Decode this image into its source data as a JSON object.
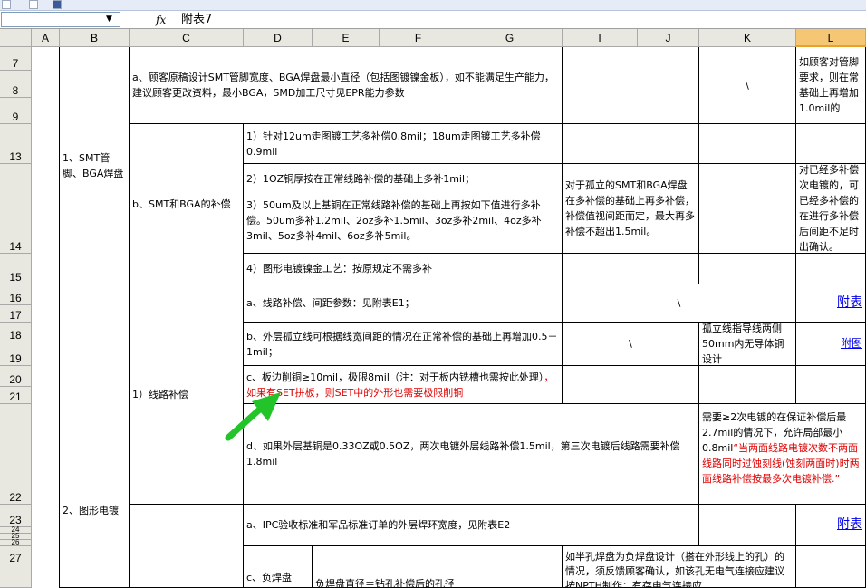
{
  "toolbar": {
    "icons": [
      "pdf-icon",
      "pdf-icon",
      "menu-icon"
    ]
  },
  "formula_bar": {
    "name_box": "",
    "fx": "fx",
    "value": "附表7"
  },
  "columns": [
    "A",
    "B",
    "C",
    "D",
    "E",
    "F",
    "G",
    "I",
    "J",
    "K",
    "L"
  ],
  "rows": [
    "7",
    "8",
    "9",
    "13",
    "14",
    "15",
    "16",
    "17",
    "18",
    "19",
    "20",
    "21",
    "22",
    "23",
    "24",
    "25",
    "26",
    "27"
  ],
  "cells": {
    "b_smt": "1、SMT管脚、BGA焊盘",
    "b_plating": "2、图形电镀",
    "c_smt_a": "a、顾客原稿设计SMT管脚宽度、BGA焊盘最小直径（包括图镀镍金板），如不能满足生产能力，建议顾客更改资料，最小BGA，SMD加工尺寸见EPR能力参数",
    "k_smt_a": "\\",
    "l_smt_a": "如顾客对管脚要求，则在常基础上再增加1.0mil的",
    "c_smt_b": "b、SMT和BGA的补偿",
    "d_13": "1）针对12um走图镀工艺多补偿0.8mil；18um走图镀工艺多补偿0.9mil",
    "d_14a": "2）1OZ铜厚按在正常线路补偿的基础上多补1mil；",
    "d_14b": "3）50um及以上基铜在正常线路补偿的基础上再按如下值进行多补偿。50um多补1.2mil、2oz多补1.5mil、3oz多补2mil、4oz多补3mil、5oz多补4mil、6oz多补5mil。",
    "i_14": "对于孤立的SMT和BGA焊盘在多补偿的基础上再多补偿，补偿值视间距而定，最大再多补偿不超出1.5mil。",
    "l_14": "对已经多补偿次电镀的，可已经多补偿的在进行多补偿后间距不足时出确认。",
    "d_15": "4）图形电镀镍金工艺：按原规定不需多补",
    "c_line": "1）线路补偿",
    "d_16": "a、线路补偿、间距参数：见附表E1；",
    "i_16": "\\",
    "l_16": "附表",
    "d_18": "b、外层孤立线可根据线宽间距的情况在正常补偿的基础上再增加0.5－1mil；",
    "i_18": "\\",
    "k_18": "孤立线指导线两侧50mm内无导体铜设计",
    "l_18": "附图",
    "d_20_black": "c、板边削铜≥10mil，极限8mil（注：对于板内铣槽也需按此处理）",
    "d_20_red": "，如果有SET拼板，则SET中的外形也需要极限削铜",
    "d_22": "d、如果外层基铜是0.33OZ或0.5OZ，两次电镀外层线路补偿1.5mil，第三次电镀后线路需要补偿1.8mil",
    "k_22_black": "需要≥2次电镀的在保证补偿后最2.7mil的情况下，允许局部最小0.8mil",
    "k_22_red": "“当两面线路电镀次数不两面线路同时过蚀刻线(蚀刻两面时)时两面线路补偿按最多次电镀补偿.”",
    "d_23": "a、IPC验收标准和军品标准订单的外层焊环宽度，见附表E2",
    "l_23": "附表",
    "d_27": "c、负焊盘",
    "e_27": "负焊盘直径＝钻孔补偿后的孔径",
    "i_27": "如半孔焊盘为负焊盘设计（搭在外形线上的孔）的情况，须反馈顾客确认，如该孔无电气连接应建议按NPTH制作；有存电气连接应"
  },
  "colors": {
    "accent_header": "#f5c774",
    "red_text": "#e00000",
    "link": "#0000ee",
    "arrow": "#22c42a"
  }
}
